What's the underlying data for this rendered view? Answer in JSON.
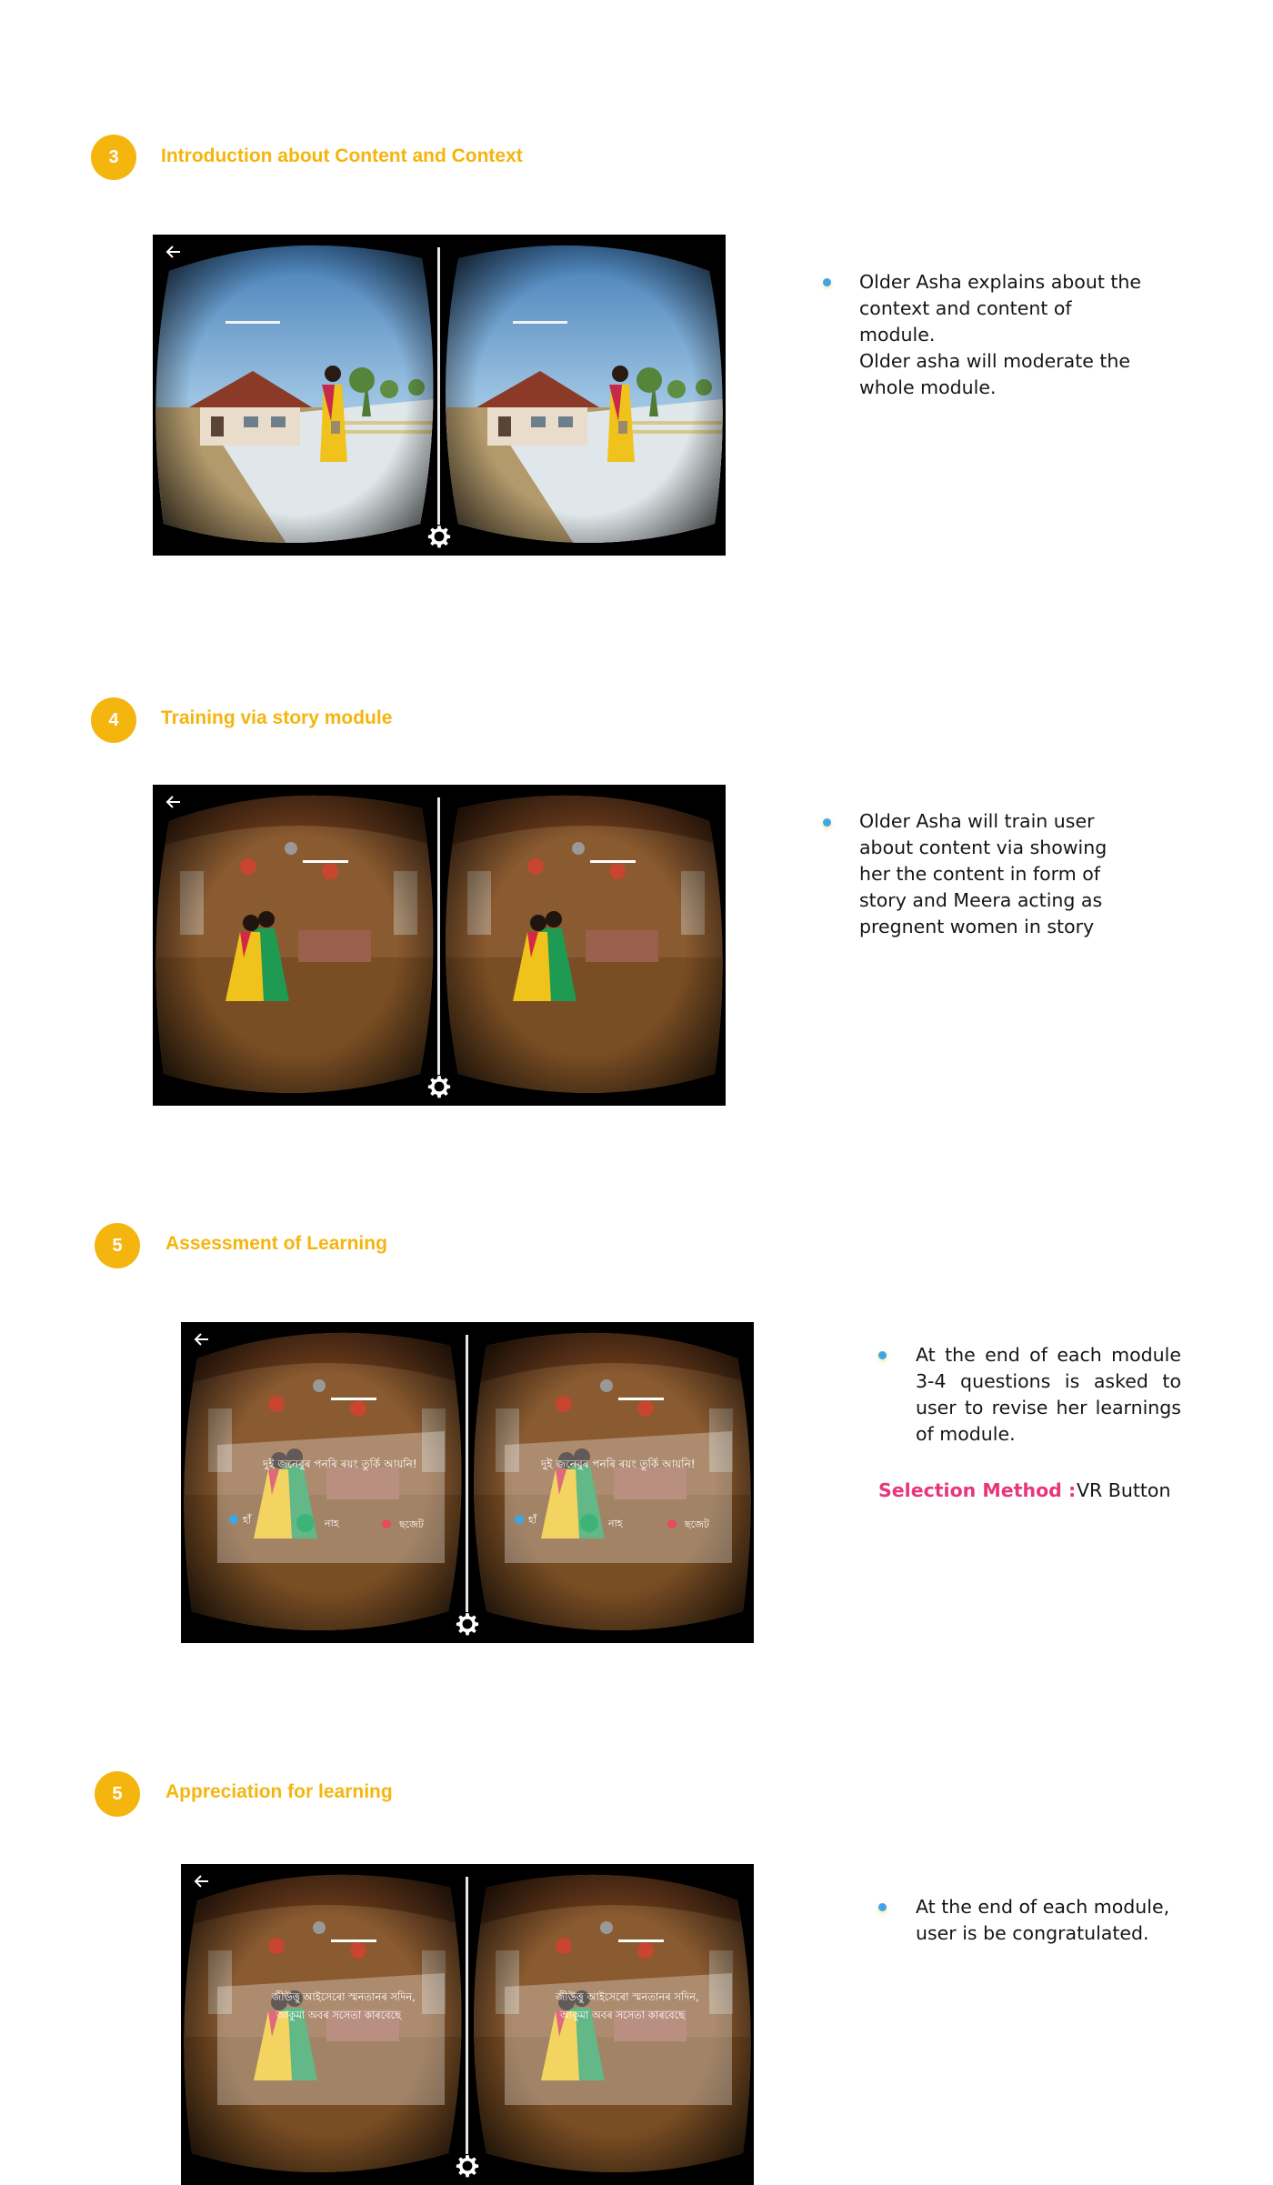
{
  "sections": [
    {
      "number": "3",
      "title": "Introduction about Content and Context",
      "bullet_lines": [
        "Older Asha explains about the context and content of module.",
        "Older asha will moderate the whole module."
      ]
    },
    {
      "number": "4",
      "title": "Training via story module",
      "bullet_lines": [
        "Older Asha will train user about content via showing her the content in form of story and Meera acting as pregnent women in story"
      ]
    },
    {
      "number": "5",
      "title": "Assessment of Learning",
      "bullet_lines": [
        "At the end of each module 3-4 questions is asked to user to revise her learnings of module."
      ],
      "selection_method": {
        "label": "Selection Method :",
        "value": "VR Button"
      }
    },
    {
      "number": "5",
      "title": "Appreciation for learning",
      "bullet_lines": [
        "At the end of each module, user is be congratulated."
      ]
    }
  ],
  "vr_overlay": {
    "question": "দুই জনেবুৰ পনৰি ৰয়ং তুৰ্কি আয়নি!",
    "options": [
      "হাঁ",
      "নাহ",
      "ছজেট"
    ],
    "congrats_line1": "জীউত্তু আইসেৰো স্মনতানৰ সদিন,",
    "congrats_line2": "আকুমা অবৰ সসেতা কাৰবেছে"
  },
  "icons": [
    "back-arrow-icon",
    "gear-icon",
    "bullet-dot-icon"
  ],
  "colors": {
    "accent": "#f5b50f",
    "bullet": "#3ea6e8",
    "selection_label": "#e8367a"
  }
}
